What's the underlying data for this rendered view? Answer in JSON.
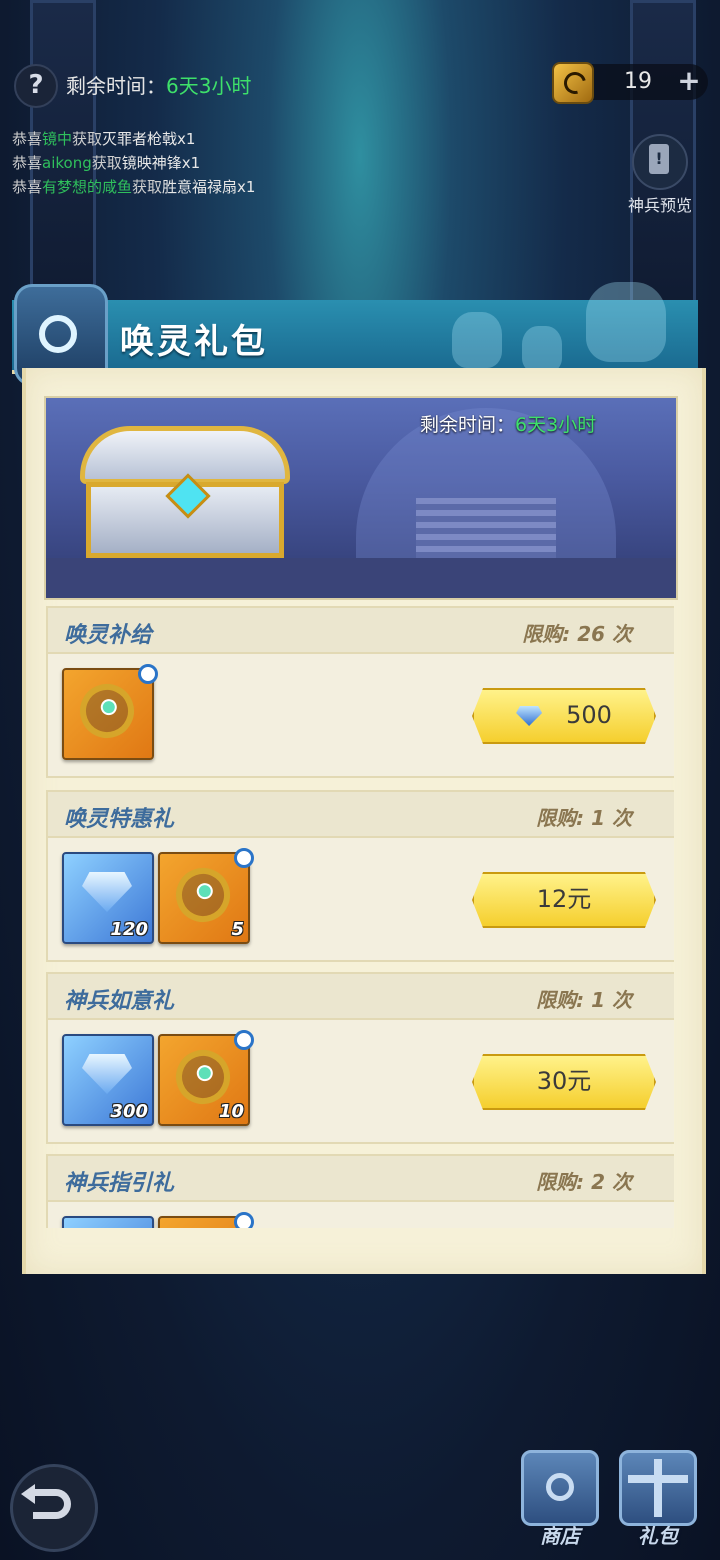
{
  "top": {
    "help_icon": "question-mark",
    "timer_label": "剩余时间：",
    "timer_value": "6天3小时",
    "currency_value": "19",
    "currency_add": "+"
  },
  "broadcasts": [
    {
      "prefix": "恭喜",
      "player": "镜中",
      "action": "获取",
      "item": "灭罪者枪戟x1"
    },
    {
      "prefix": "恭喜",
      "player": "aikong",
      "action": "获取",
      "item": "镜映神锋x1"
    },
    {
      "prefix": "恭喜",
      "player": "有梦想的咸鱼",
      "action": "获取",
      "item": "胜意福禄扇x1"
    }
  ],
  "preview": {
    "label": "神兵预览"
  },
  "panel": {
    "title": "唤灵礼包",
    "banner_timer_label": "剩余时间：",
    "banner_timer_value": "6天3小时"
  },
  "packages": [
    {
      "name": "唤灵补给",
      "limit": "限购: 26 次",
      "items": [
        {
          "type": "weapon",
          "qty": ""
        }
      ],
      "price": "500",
      "price_icon": "diamond"
    },
    {
      "name": "唤灵特惠礼",
      "limit": "限购: 1 次",
      "items": [
        {
          "type": "diamond",
          "qty": "120"
        },
        {
          "type": "weapon",
          "qty": "5"
        }
      ],
      "price": "12元"
    },
    {
      "name": "神兵如意礼",
      "limit": "限购: 1 次",
      "items": [
        {
          "type": "diamond",
          "qty": "300"
        },
        {
          "type": "weapon",
          "qty": "10"
        }
      ],
      "price": "30元"
    },
    {
      "name": "神兵指引礼",
      "limit": "限购: 2 次",
      "items": [
        {
          "type": "diamond",
          "qty": ""
        },
        {
          "type": "weapon",
          "qty": ""
        }
      ],
      "price": ""
    }
  ],
  "bottom": {
    "back_icon": "back-arrow",
    "shop_label": "商店",
    "gift_label": "礼包"
  },
  "colors": {
    "highlight_green": "#3ee06a",
    "title_blue": "#3e6c9c",
    "button_gold": "#f5cf2e"
  }
}
